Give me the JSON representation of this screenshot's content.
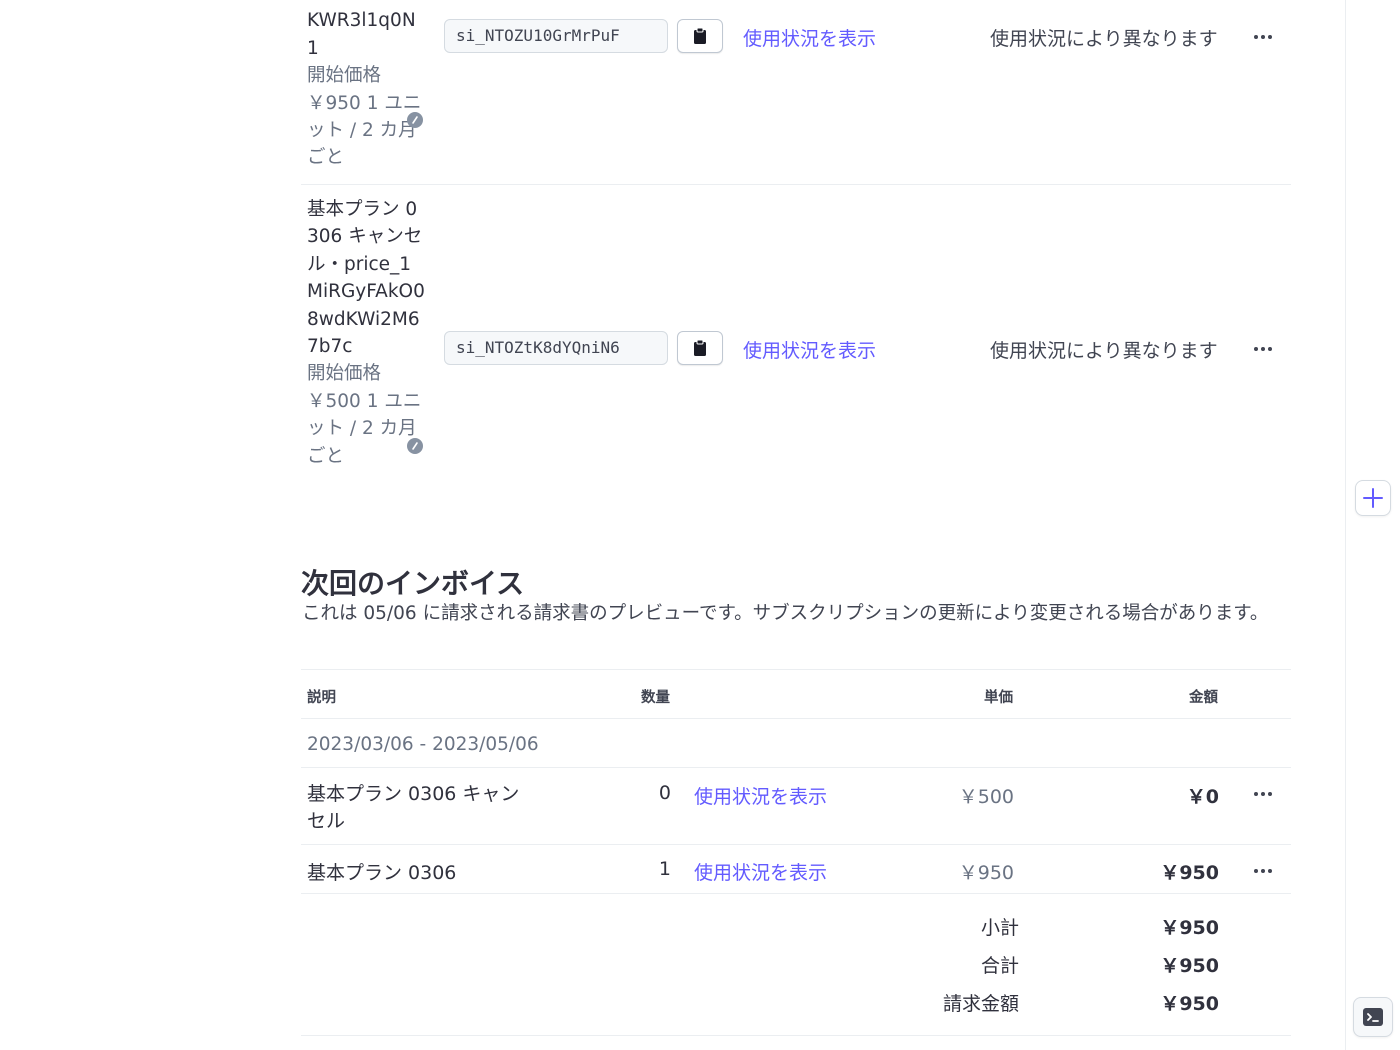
{
  "subscription_items": [
    {
      "name_tail": "KWR3l1q0N1",
      "price_label": "開始価格",
      "price_text": "￥950 1 ユニット / 2 カ月ごと",
      "item_id": "si_NTOZU10GrMrPuF",
      "usage_link": "使用状況を表示",
      "quantity_text": "使用状況により異なります"
    },
    {
      "name": "基本プラン 0306 キャンセル・price_1MiRGyFAkO08wdKWi2M67b7c",
      "price_label": "開始価格",
      "price_text": "￥500 1 ユニット / 2 カ月ごと",
      "item_id": "si_NTOZtK8dYQniN6",
      "usage_link": "使用状況を表示",
      "quantity_text": "使用状況により異なります"
    }
  ],
  "upcoming_invoice": {
    "title": "次回のインボイス",
    "subtitle": "これは 05/06 に請求される請求書のプレビューです。サブスクリプションの更新により変更される場合があります。",
    "columns": {
      "description": "説明",
      "quantity": "数量",
      "unit_price": "単価",
      "amount": "金額"
    },
    "period": "2023/03/06 - 2023/05/06",
    "lines": [
      {
        "description": "基本プラン 0306 キャンセル",
        "quantity": "0",
        "usage_link": "使用状況を表示",
        "unit_price": "￥500",
        "amount": "￥0"
      },
      {
        "description": "基本プラン 0306",
        "quantity": "1",
        "usage_link": "使用状況を表示",
        "unit_price": "￥950",
        "amount": "￥950"
      }
    ],
    "totals": [
      {
        "label": "小計",
        "value": "￥950"
      },
      {
        "label": "合計",
        "value": "￥950"
      },
      {
        "label": "請求金額",
        "value": "￥950"
      }
    ]
  },
  "colors": {
    "link": "#635bff",
    "text": "#30313d",
    "muted": "#6a7383",
    "divider": "#ebeef1"
  },
  "icons": {
    "copy": "clipboard-icon",
    "more": "more-horizontal-icon",
    "add": "plus-icon",
    "shell": "terminal-icon",
    "price_info": "meter-icon"
  }
}
